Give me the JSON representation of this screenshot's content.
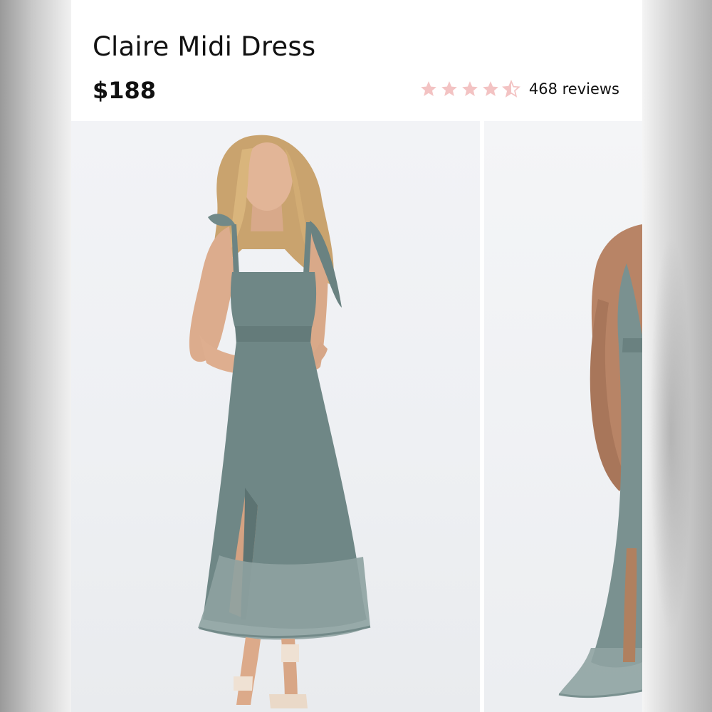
{
  "product": {
    "title": "Claire Midi Dress",
    "price": "$188"
  },
  "rating": {
    "value": 4.5,
    "max": 5,
    "reviews_label": "468 reviews",
    "star_color": "#f3c3c3"
  },
  "gallery": {
    "images": [
      {
        "name": "dress-front-photo",
        "dress_color": "#6f8786"
      },
      {
        "name": "dress-side-photo",
        "dress_color": "#7a9190"
      }
    ]
  }
}
